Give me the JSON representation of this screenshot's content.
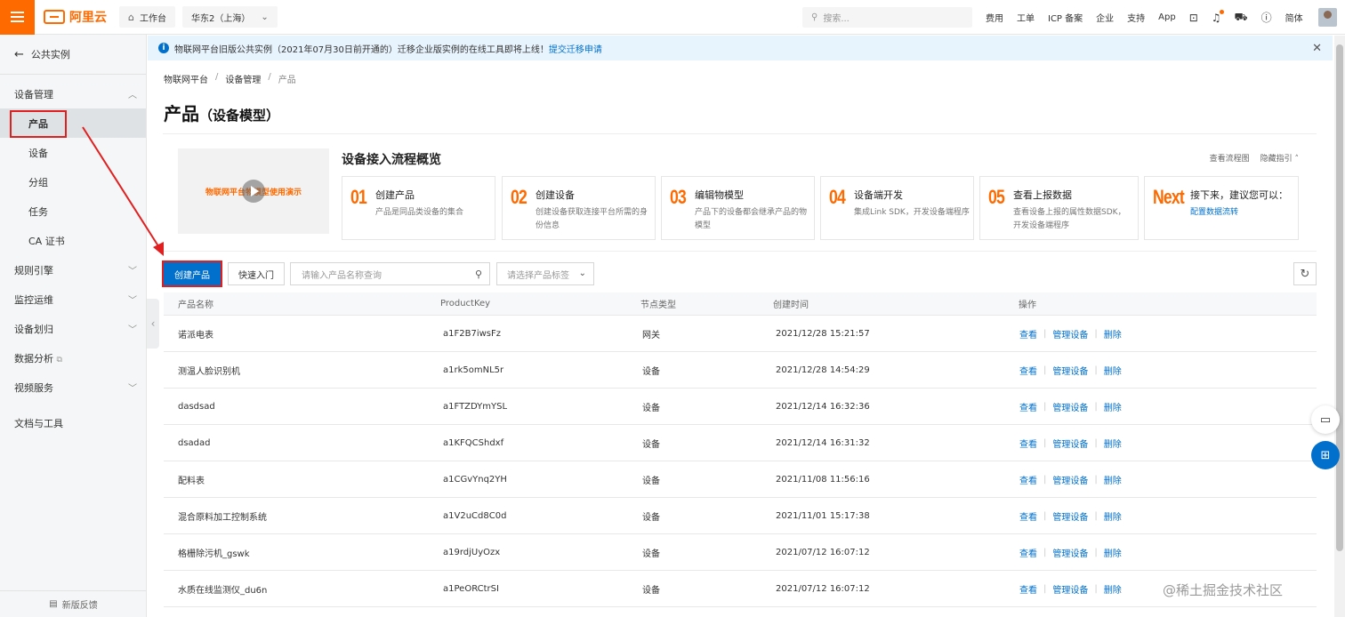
{
  "topbar": {
    "brand": "阿里云",
    "workbench": "工作台",
    "region": "华东2（上海）",
    "search_placeholder": "搜索...",
    "nav": [
      "费用",
      "工单",
      "ICP 备案",
      "企业",
      "支持",
      "App"
    ],
    "lang": "简体"
  },
  "sidebar": {
    "back": "公共实例",
    "groups": [
      {
        "label": "设备管理",
        "expanded": true,
        "items": [
          "产品",
          "设备",
          "分组",
          "任务",
          "CA 证书"
        ],
        "active": "产品"
      },
      {
        "label": "规则引擎"
      },
      {
        "label": "监控运维"
      },
      {
        "label": "设备划归"
      },
      {
        "label": "数据分析"
      },
      {
        "label": "视频服务"
      },
      {
        "label": "文档与工具"
      }
    ],
    "footer": "新版反馈"
  },
  "notice": {
    "text": "物联网平台旧版公共实例（2021年07月30日前开通的）迁移企业版实例的在线工具即将上线！",
    "link": "提交迁移申请"
  },
  "breadcrumb": [
    "物联网平台",
    "设备管理",
    "产品"
  ],
  "page": {
    "title": "产品",
    "subtitle": "（设备模型）"
  },
  "guide": {
    "video_text": "物联网平台物模型使用演示",
    "title": "设备接入流程概览",
    "link_flow": "查看流程图",
    "link_hide": "隐藏指引",
    "steps": [
      {
        "num": "01",
        "title": "创建产品",
        "desc": "产品是同品类设备的集合"
      },
      {
        "num": "02",
        "title": "创建设备",
        "desc": "创建设备获取连接平台所需的身份信息"
      },
      {
        "num": "03",
        "title": "编辑物模型",
        "desc": "产品下的设备都会继承产品的物模型"
      },
      {
        "num": "04",
        "title": "设备端开发",
        "desc": "集成Link SDK，开发设备端程序"
      },
      {
        "num": "05",
        "title": "查看上报数据",
        "desc": "查看设备上报的属性数据SDK，开发设备端程序"
      },
      {
        "num": "Next",
        "title": "接下来，建议您可以：",
        "desc": "配置数据流转"
      }
    ]
  },
  "toolbar": {
    "create": "创建产品",
    "quickstart": "快速入门",
    "search_placeholder": "请输入产品名称查询",
    "tag_placeholder": "请选择产品标签"
  },
  "table": {
    "headers": [
      "产品名称",
      "ProductKey",
      "节点类型",
      "创建时间",
      "操作"
    ],
    "actions": [
      "查看",
      "管理设备",
      "删除"
    ],
    "rows": [
      [
        "诺派电表",
        "a1F2B7iwsFz",
        "网关",
        "2021/12/28 15:21:57"
      ],
      [
        "测温人脸识别机",
        "a1rk5omNL5r",
        "设备",
        "2021/12/28 14:54:29"
      ],
      [
        "dasdsad",
        "a1FTZDYmYSL",
        "设备",
        "2021/12/14 16:32:36"
      ],
      [
        "dsadad",
        "a1KFQCShdxf",
        "设备",
        "2021/12/14 16:31:32"
      ],
      [
        "配料表",
        "a1CGvYnq2YH",
        "设备",
        "2021/11/08 11:56:16"
      ],
      [
        "混合原料加工控制系统",
        "a1V2uCd8C0d",
        "设备",
        "2021/11/01 15:17:38"
      ],
      [
        "格栅除污机_gswk",
        "a19rdjUyOzx",
        "设备",
        "2021/07/12 16:07:12"
      ],
      [
        "水质在线监测仪_du6n",
        "a1PeORCtrSI",
        "设备",
        "2021/07/12 16:07:12"
      ]
    ]
  },
  "watermark": "@稀土掘金技术社区",
  "colors": {
    "accent": "#ff6a00",
    "primary": "#0070cc",
    "annotation": "#e02020"
  }
}
